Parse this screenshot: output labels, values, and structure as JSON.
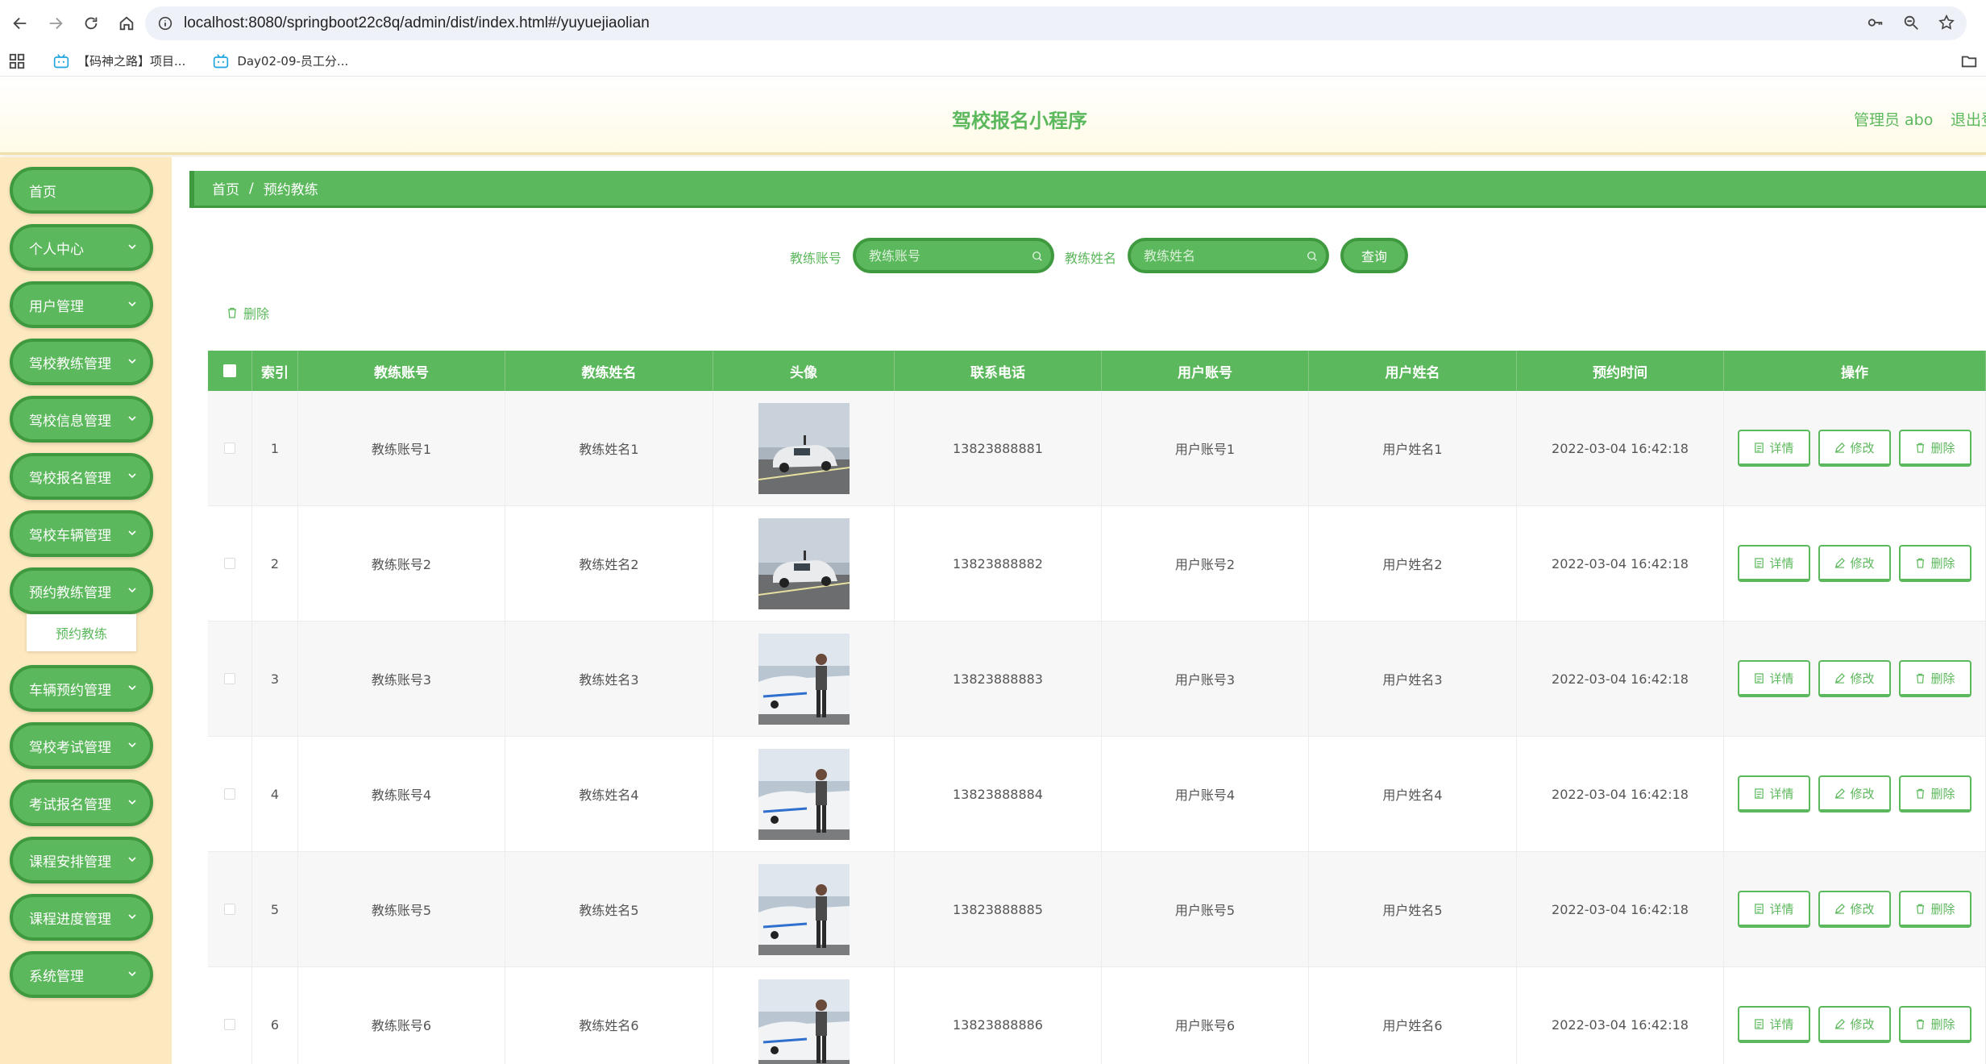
{
  "browser": {
    "url": "localhost:8080/springboot22c8q/admin/dist/index.html#/yuyuejiaolian",
    "bookmarks": [
      "【码神之路】项目...",
      "Day02-09-员工分..."
    ]
  },
  "header": {
    "title": "驾校报名小程序",
    "admin": "管理员 abo",
    "logout": "退出登"
  },
  "sidebar": {
    "items": [
      {
        "label": "首页",
        "has_arrow": false
      },
      {
        "label": "个人中心",
        "has_arrow": true
      },
      {
        "label": "用户管理",
        "has_arrow": true
      },
      {
        "label": "驾校教练管理",
        "has_arrow": true
      },
      {
        "label": "驾校信息管理",
        "has_arrow": true
      },
      {
        "label": "驾校报名管理",
        "has_arrow": true
      },
      {
        "label": "驾校车辆管理",
        "has_arrow": true
      },
      {
        "label": "预约教练管理",
        "has_arrow": true
      },
      {
        "label": "车辆预约管理",
        "has_arrow": true
      },
      {
        "label": "驾校考试管理",
        "has_arrow": true
      },
      {
        "label": "考试报名管理",
        "has_arrow": true
      },
      {
        "label": "课程安排管理",
        "has_arrow": true
      },
      {
        "label": "课程进度管理",
        "has_arrow": true
      },
      {
        "label": "系统管理",
        "has_arrow": true
      }
    ],
    "submenu_label": "预约教练"
  },
  "breadcrumb": {
    "home": "首页",
    "separator": "/",
    "current": "预约教练"
  },
  "search": {
    "account_label": "教练账号",
    "account_placeholder": "教练账号",
    "name_label": "教练姓名",
    "name_placeholder": "教练姓名",
    "query_button": "查询"
  },
  "batch_delete": "删除",
  "table": {
    "headers": [
      "索引",
      "教练账号",
      "教练姓名",
      "头像",
      "联系电话",
      "用户账号",
      "用户姓名",
      "预约时间",
      "操作"
    ],
    "rows": [
      {
        "index": "1",
        "coach_account": "教练账号1",
        "coach_name": "教练姓名1",
        "photo": "car-photo",
        "phone": "13823888881",
        "user_account": "用户账号1",
        "user_name": "用户姓名1",
        "time": "2022-03-04 16:42:18"
      },
      {
        "index": "2",
        "coach_account": "教练账号2",
        "coach_name": "教练姓名2",
        "photo": "car-photo",
        "phone": "13823888882",
        "user_account": "用户账号2",
        "user_name": "用户姓名2",
        "time": "2022-03-04 16:42:18"
      },
      {
        "index": "3",
        "coach_account": "教练账号3",
        "coach_name": "教练姓名3",
        "photo": "coach-photo",
        "phone": "13823888883",
        "user_account": "用户账号3",
        "user_name": "用户姓名3",
        "time": "2022-03-04 16:42:18"
      },
      {
        "index": "4",
        "coach_account": "教练账号4",
        "coach_name": "教练姓名4",
        "photo": "coach-photo",
        "phone": "13823888884",
        "user_account": "用户账号4",
        "user_name": "用户姓名4",
        "time": "2022-03-04 16:42:18"
      },
      {
        "index": "5",
        "coach_account": "教练账号5",
        "coach_name": "教练姓名5",
        "photo": "coach-photo",
        "phone": "13823888885",
        "user_account": "用户账号5",
        "user_name": "用户姓名5",
        "time": "2022-03-04 16:42:18"
      },
      {
        "index": "6",
        "coach_account": "教练账号6",
        "coach_name": "教练姓名6",
        "photo": "coach-photo",
        "phone": "13823888886",
        "user_account": "用户账号6",
        "user_name": "用户姓名6",
        "time": "2022-03-04 16:42:18"
      }
    ],
    "actions": {
      "detail": "详情",
      "edit": "修改",
      "delete": "删除"
    }
  },
  "colors": {
    "primary": "#5cb85c",
    "primary_dark": "#3f9a3f",
    "sidebar_bg": "#fde9bf"
  }
}
